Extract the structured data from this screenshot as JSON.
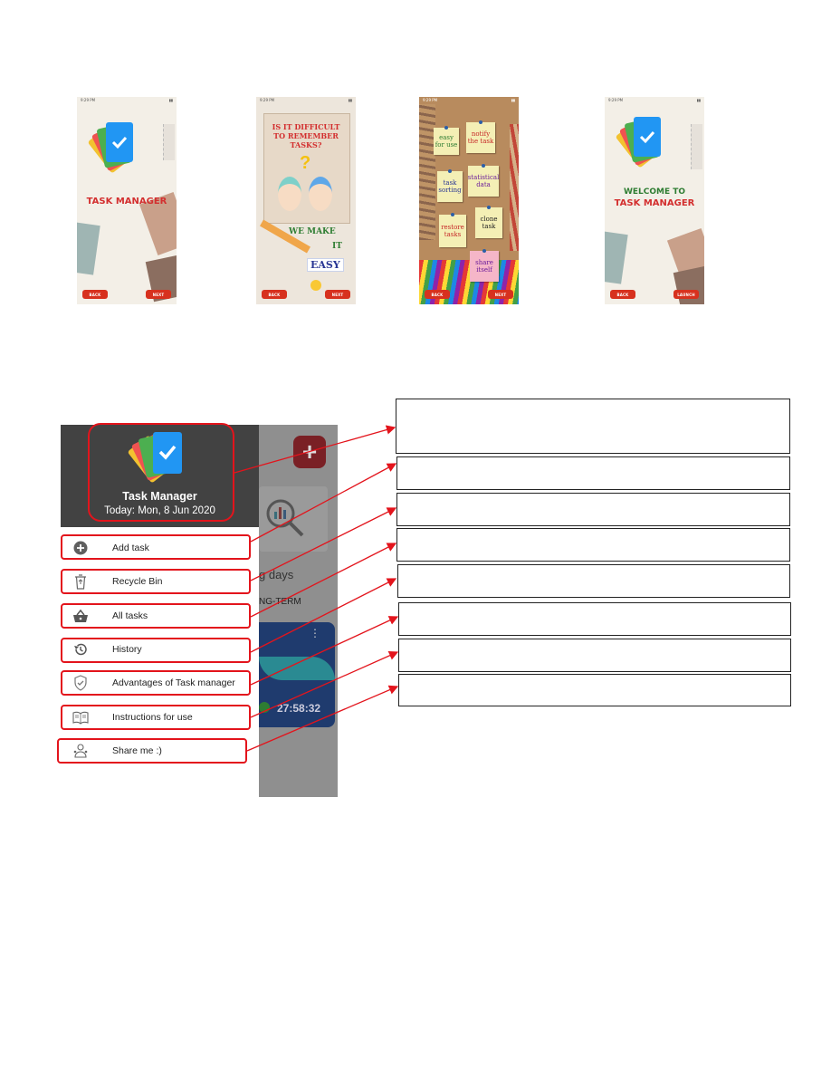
{
  "onboarding": {
    "screens": [
      {
        "title": "TASK MANAGER",
        "back": "BACK",
        "next": "NEXT"
      },
      {
        "question": [
          "IS IT DIFFICULT",
          "TO REMEMBER",
          "TASKS?"
        ],
        "answer": [
          "WE MAKE",
          "IT"
        ],
        "easy": "EASY",
        "back": "BACK",
        "next": "NEXT"
      },
      {
        "notes": [
          "easy for use",
          "notify the task",
          "task sorting",
          "statistical data",
          "restore tasks",
          "clone task",
          "share itself"
        ],
        "back": "BACK",
        "next": "NEXT"
      },
      {
        "title": [
          "WELCOME TO",
          "TASK MANAGER"
        ],
        "back": "BACK",
        "next": "LAUNCH"
      }
    ],
    "status_time": "9:29 PM"
  },
  "drawer": {
    "app_name": "Task Manager",
    "today": "Today: Mon, 8 Jun 2020",
    "items": [
      {
        "label": "Add task",
        "icon": "add-circle-icon"
      },
      {
        "label": "Recycle Bin",
        "icon": "recycle-bin-icon"
      },
      {
        "label": "All tasks",
        "icon": "basket-icon"
      },
      {
        "label": "History",
        "icon": "history-icon"
      },
      {
        "label": "Advantages of Task manager",
        "icon": "shield-check-icon"
      },
      {
        "label": "Instructions for use",
        "icon": "open-book-icon"
      },
      {
        "label": "Share me :)",
        "icon": "share-person-icon"
      }
    ]
  },
  "background_screen": {
    "partial_title": "g days",
    "partial_tab": "NG-TERM",
    "timer": "27:58:32"
  },
  "colors": {
    "highlight": "#e3141c",
    "drawer_header": "#424242",
    "button_red": "#d7311e",
    "card_blue": "#1f3b6e"
  }
}
